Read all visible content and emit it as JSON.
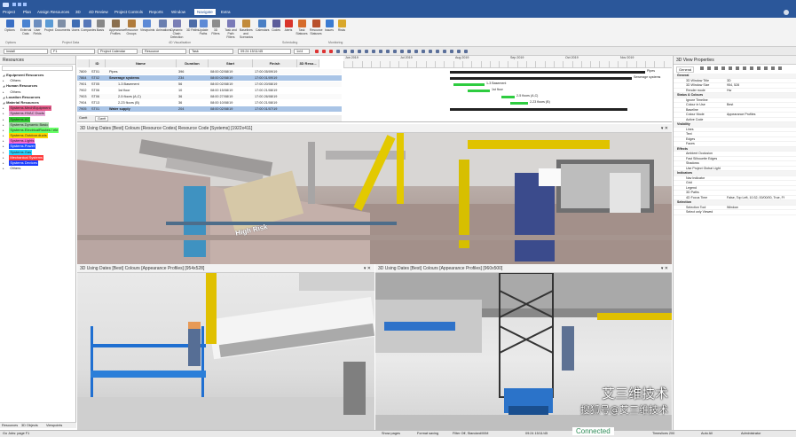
{
  "app": {
    "tabs": [
      "Project",
      "Plan",
      "Assign Resources",
      "3D",
      "4D Review",
      "Project Controls",
      "Reports",
      "Window",
      "Navigate",
      "Extra"
    ],
    "active_tab": "Navigate"
  },
  "ribbon": {
    "buttons": [
      "Options",
      "External Data",
      "User Fields",
      "Project",
      "Documents",
      "Users",
      "Companies",
      "Basis",
      "Appearance Profiles",
      "Resource Groups",
      "Viewpoints",
      "Animations",
      "Dynamic Clash Detection",
      "3D Paths",
      "Update Paths",
      "3D Filters",
      "Task and Path Filters",
      "Baselines and Scenarios",
      "Calendars",
      "Codes",
      "Alerts",
      "Task Statuses",
      "Resource Statuses",
      "Issues",
      "Risks"
    ],
    "groups": [
      "Options",
      "Project Data",
      "4D Visualisation",
      "Scheduling",
      "Monitoring"
    ]
  },
  "subtoolbar": {
    "combo1": "Install",
    "combo2": "F1",
    "combo3": "Project Calendar",
    "combo4": "Resource",
    "combo5": "Task",
    "combo6": "09:24 15/11/45",
    "combo7": "1x/4"
  },
  "resources": {
    "title": "Resources",
    "items": [
      {
        "label": "Equipment Resources",
        "indent": 0,
        "color": "#ffffff"
      },
      {
        "label": "Others",
        "indent": 1,
        "color": "#ffffff"
      },
      {
        "label": "Human Resources",
        "indent": 0,
        "color": "#ffffff"
      },
      {
        "label": "Others",
        "indent": 1,
        "color": "#ffffff"
      },
      {
        "label": "Location Resources",
        "indent": 0,
        "color": "#ffffff"
      },
      {
        "label": "Material Resources",
        "indent": 0,
        "color": "#ffffff"
      },
      {
        "label": "Systems.MechEquipment",
        "indent": 1,
        "color": "#e55c8a"
      },
      {
        "label": "Systems.HVAC Ducts",
        "indent": 1,
        "color": "#e8a7d7"
      },
      {
        "label": "Systems.AC",
        "indent": 1,
        "color": "#33cc33"
      },
      {
        "label": "Systems.Dynamic Basic",
        "indent": 1,
        "color": "#a5d6a7"
      },
      {
        "label": "Systems.ElectricalRoutes / ele",
        "indent": 1,
        "color": "#66ff66"
      },
      {
        "label": "Systems.Outdoor.ducts",
        "indent": 1,
        "color": "#ffd400"
      },
      {
        "label": "Systems.Lights",
        "indent": 1,
        "color": "#ff6ad5"
      },
      {
        "label": "Systems.Power",
        "indent": 1,
        "color": "#1f4fff"
      },
      {
        "label": "Systems.Gas",
        "indent": 1,
        "color": "#28d4ff"
      },
      {
        "label": "Mechanical Systems",
        "indent": 1,
        "color": "#ff3b3b"
      },
      {
        "label": "Systems Devices",
        "indent": 1,
        "color": "#1a3cff"
      },
      {
        "label": "Others",
        "indent": 1,
        "color": "#ffffff"
      }
    ],
    "tabs": [
      "Resources",
      "3D Objects",
      "Viewpoints"
    ]
  },
  "gantt": {
    "headers": [
      "",
      "ID",
      "Name",
      "Duration",
      "Start",
      "Finish",
      "3D Reso..."
    ],
    "rows": [
      {
        "num": "7809",
        "id": "ST01",
        "name": "Pipes",
        "dur": "396",
        "start": "08:00 02/08/19",
        "finish": "17:00 05/09/19",
        "sel": false
      },
      {
        "num": "7864",
        "id": "ST02",
        "name": "Sewerage systems",
        "dur": "234",
        "start": "08:00 02/08/19",
        "finish": "17:00 01/09/19",
        "sel": true
      },
      {
        "num": "7901",
        "id": "ST05",
        "name": "1-3 Basement",
        "dur": "56",
        "start": "08:00 02/08/19",
        "finish": "17:00 20/08/19",
        "sel": false
      },
      {
        "num": "7902",
        "id": "ST06",
        "name": "1st floor",
        "dur": "10",
        "start": "08:00 15/08/19",
        "finish": "17:00 21/08/19",
        "sel": false
      },
      {
        "num": "7903",
        "id": "ST06",
        "name": "2-5 floors (A,C)",
        "dur": "36",
        "start": "08:00 27/08/19",
        "finish": "17:00 26/08/19",
        "sel": false
      },
      {
        "num": "7904",
        "id": "ST13",
        "name": "2-23 floors (B)",
        "dur": "36",
        "start": "08:00 10/08/19",
        "finish": "17:00 21/08/19",
        "sel": false
      },
      {
        "num": "7905",
        "id": "ST01",
        "name": "Water supply",
        "dur": "204",
        "start": "08:00 02/08/19",
        "finish": "17:00 01/07/19",
        "sel": true
      }
    ],
    "months": [
      "Jun 2019",
      "Jul 2019",
      "Aug 2019",
      "Sep 2019",
      "Oct 2019",
      "Nov 2019"
    ],
    "bar_labels": [
      "Pipes",
      "Sewerage systems",
      "1-3 Basement",
      "1st floor",
      "2-5 floors (A,C)",
      "2-23 floors (B)"
    ],
    "tabs": [
      "Gantt",
      "Gantt"
    ]
  },
  "views": [
    {
      "title": "3D Using Dates [Best] Colours [Resource Codes] Resource Code [Systems] [1922x411]"
    },
    {
      "title": "3D Using Dates [Best] Colours [Appearance Profiles] [954x528]"
    },
    {
      "title": "3D Using Dates [Best] Colours [Appearance Profiles] [960x500]"
    }
  ],
  "scene": {
    "sign_text": "High Risk"
  },
  "props": {
    "title": "3D View Properties",
    "tab": "General",
    "rows": [
      {
        "k": "General",
        "v": "",
        "sec": true
      },
      {
        "k": "3D Window Title",
        "v": "3D",
        "sec": false
      },
      {
        "k": "3D Window Size",
        "v": "954, 528",
        "sec": false
      },
      {
        "k": "Render mode",
        "v": "Hw",
        "sec": false
      },
      {
        "k": "Status & Colours",
        "v": "",
        "sec": true
      },
      {
        "k": "Ignore Timeline",
        "v": "",
        "sec": false
      },
      {
        "k": "Colour in Use",
        "v": "Best",
        "sec": false
      },
      {
        "k": "Baseline",
        "v": "",
        "sec": false
      },
      {
        "k": "Colour Mode",
        "v": "Appearance Profiles",
        "sec": false
      },
      {
        "k": "Active Code",
        "v": "",
        "sec": false
      },
      {
        "k": "Visibility",
        "v": "",
        "sec": true
      },
      {
        "k": "Lines",
        "v": "",
        "sec": false
      },
      {
        "k": "Text",
        "v": "",
        "sec": false
      },
      {
        "k": "Edges",
        "v": "",
        "sec": false
      },
      {
        "k": "Faces",
        "v": "",
        "sec": false
      },
      {
        "k": "Effects",
        "v": "",
        "sec": true
      },
      {
        "k": "Ambient Occlusion",
        "v": "",
        "sec": false
      },
      {
        "k": "Fast Silhouette Edges",
        "v": "",
        "sec": false
      },
      {
        "k": "Shadows",
        "v": "",
        "sec": false
      },
      {
        "k": "Use Project Global Light",
        "v": "",
        "sec": false
      },
      {
        "k": "Indicators",
        "v": "",
        "sec": true
      },
      {
        "k": "Nav Indicator",
        "v": "",
        "sec": false
      },
      {
        "k": "Grid",
        "v": "",
        "sec": false
      },
      {
        "k": "Legend",
        "v": "",
        "sec": false
      },
      {
        "k": "3D Paths",
        "v": "",
        "sec": false
      },
      {
        "k": "4D Focus Time",
        "v": "False, Top Left, 10:32, 00/00/00, True, Ff",
        "sec": false
      },
      {
        "k": "Selection",
        "v": "",
        "sec": true
      },
      {
        "k": "Selection Tool",
        "v": "Window",
        "sec": false
      },
      {
        "k": "Select only Viewed",
        "v": "",
        "sec": false
      }
    ]
  },
  "status": {
    "left": "Go Jobs: page F1",
    "items": [
      "Show pages",
      "Format saving",
      "Filter Off, Standard/00M",
      "09:24 15/11/45",
      "Connected",
      "Timeslices 200",
      "Auto All",
      "Administrator"
    ]
  },
  "watermark": {
    "line1": "艾三维技术",
    "line2": "搜狐号@艾三维技术"
  }
}
